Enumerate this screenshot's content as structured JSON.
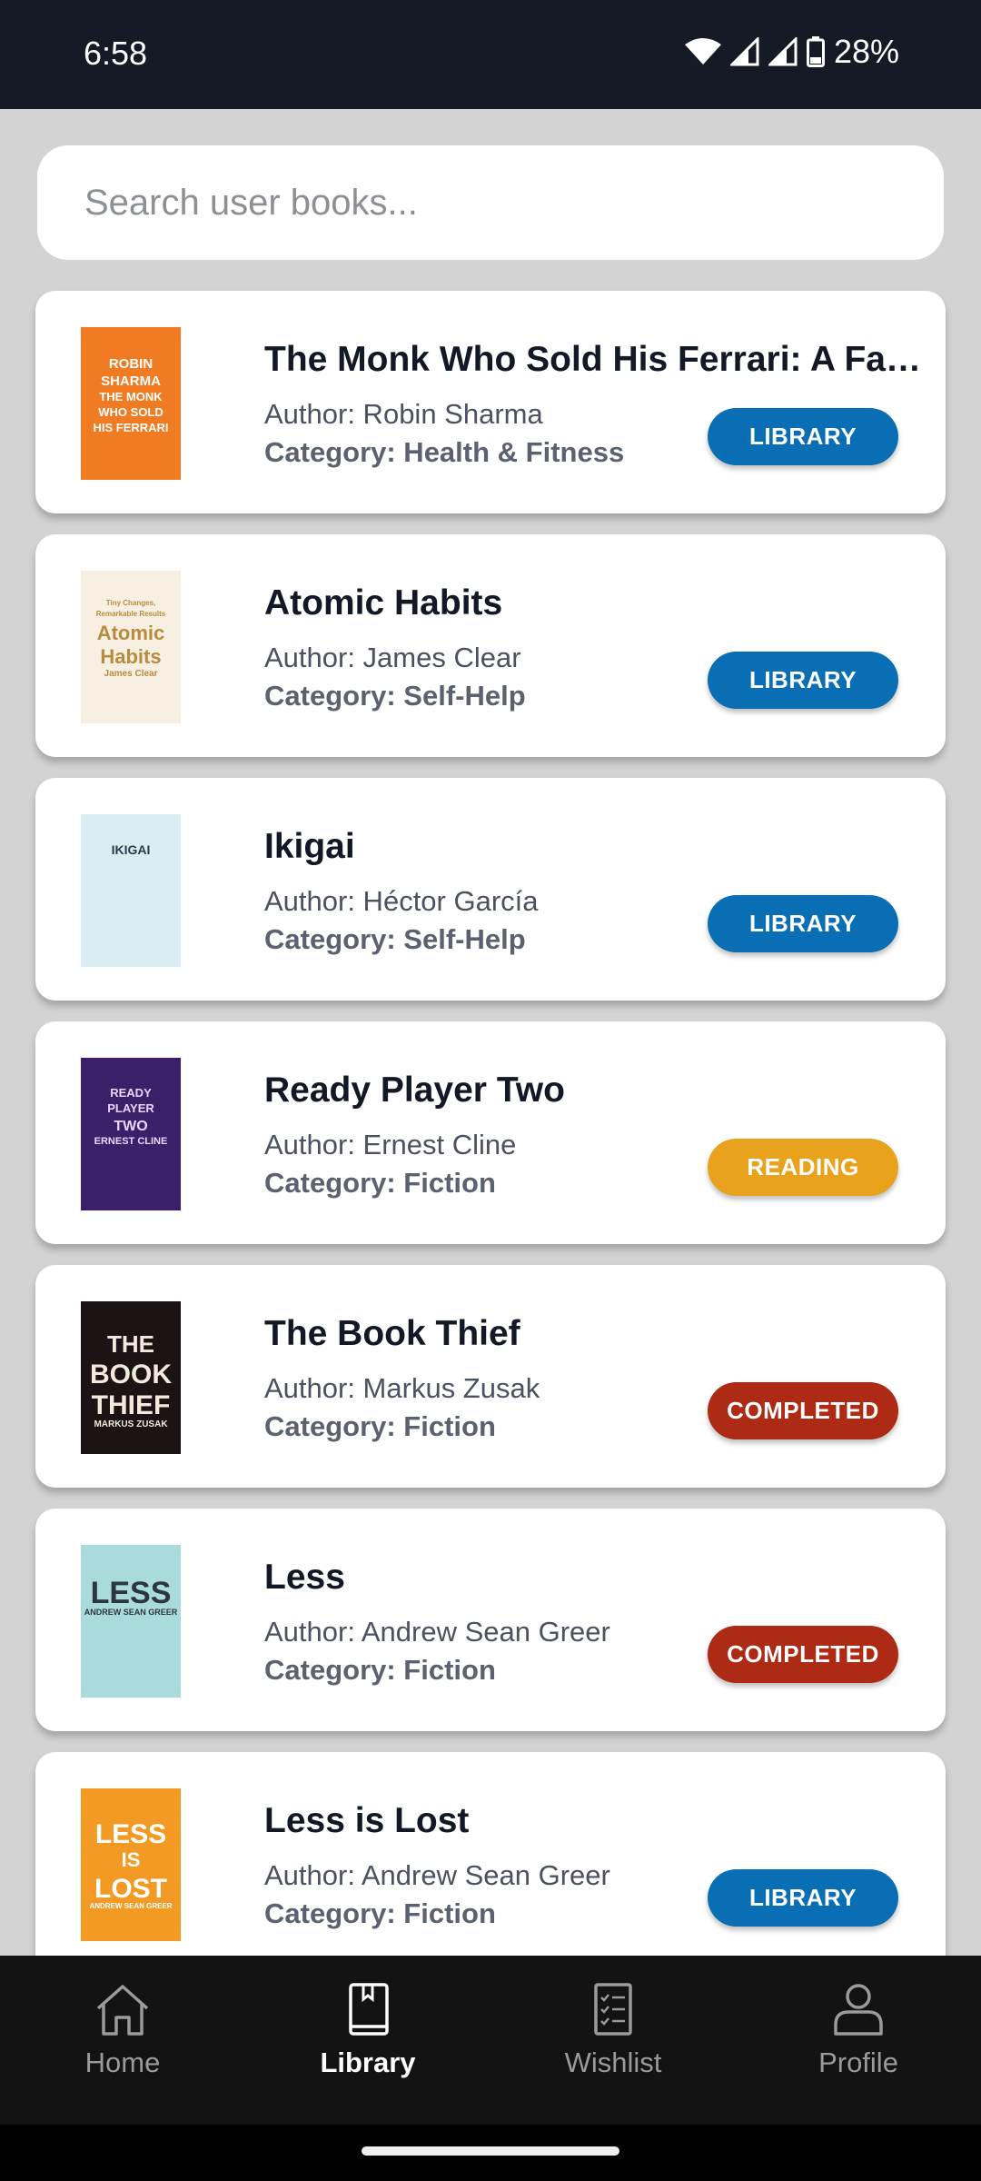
{
  "status": {
    "time": "6:58",
    "battery": "28%"
  },
  "search": {
    "placeholder": "Search user books..."
  },
  "books": [
    {
      "title": "The Monk Who Sold His Ferrari: A Fable About Fulfilling Your Dreams",
      "author": "Author: Robin Sharma",
      "category": "Category: Health & Fitness",
      "status": "LIBRARY",
      "cover_text": [
        "ROBIN",
        "SHARMA",
        "THE MONK",
        "WHO SOLD",
        "HIS FERRARI"
      ]
    },
    {
      "title": "Atomic Habits",
      "author": "Author: James Clear",
      "category": "Category: Self-Help",
      "status": "LIBRARY",
      "cover_text": [
        "Tiny Changes,",
        "Remarkable Results",
        "Atomic",
        "Habits",
        "James Clear"
      ]
    },
    {
      "title": "Ikigai",
      "author": "Author: Héctor García",
      "category": "Category: Self-Help",
      "status": "LIBRARY",
      "cover_text": [
        "IKIGAI"
      ]
    },
    {
      "title": "Ready Player Two",
      "author": "Author: Ernest Cline",
      "category": "Category: Fiction",
      "status": "READING",
      "cover_text": [
        "READY",
        "PLAYER",
        "TWO",
        "ERNEST CLINE"
      ]
    },
    {
      "title": "The Book Thief",
      "author": "Author: Markus Zusak",
      "category": "Category: Fiction",
      "status": "COMPLETED",
      "cover_text": [
        "THE",
        "BOOK",
        "THIEF",
        "MARKUS ZUSAK"
      ]
    },
    {
      "title": "Less",
      "author": "Author: Andrew Sean Greer",
      "category": "Category: Fiction",
      "status": "COMPLETED",
      "cover_text": [
        "LESS",
        "ANDREW SEAN GREER"
      ]
    },
    {
      "title": "Less is Lost",
      "author": "Author: Andrew Sean Greer",
      "category": "Category: Fiction",
      "status": "LIBRARY",
      "cover_text": [
        "LESS",
        "IS",
        "LOST",
        "ANDREW SEAN GREER"
      ]
    }
  ],
  "status_colors": {
    "LIBRARY": "#0a6eb4",
    "READING": "#e9a21b",
    "COMPLETED": "#ad2a14"
  },
  "nav": [
    {
      "label": "Home",
      "icon": "home-icon",
      "active": false
    },
    {
      "label": "Library",
      "icon": "book-icon",
      "active": true
    },
    {
      "label": "Wishlist",
      "icon": "checklist-icon",
      "active": false
    },
    {
      "label": "Profile",
      "icon": "person-icon",
      "active": false
    }
  ]
}
